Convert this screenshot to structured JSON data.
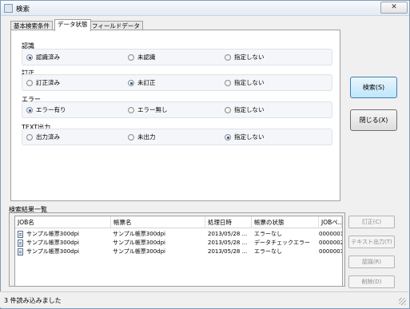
{
  "window": {
    "title": "検索",
    "close_label": "✕"
  },
  "tabs": [
    {
      "label": "基本検索条件",
      "active": false
    },
    {
      "label": "データ状態",
      "active": true
    },
    {
      "label": "フィールドデータ",
      "active": false
    }
  ],
  "groups": [
    {
      "label": "認識",
      "options": [
        "認識済み",
        "未認識",
        "指定しない"
      ],
      "selected": 0
    },
    {
      "label": "訂正",
      "options": [
        "訂正済み",
        "未訂正",
        "指定しない"
      ],
      "selected": 1
    },
    {
      "label": "エラー",
      "options": [
        "エラー有り",
        "エラー無し",
        "指定しない"
      ],
      "selected": 0
    },
    {
      "label": "TEXT出力",
      "options": [
        "出力済み",
        "未出力",
        "指定しない"
      ],
      "selected": 2
    }
  ],
  "buttons": {
    "search": "検索(S)",
    "close": "閉じる(X)"
  },
  "results": {
    "label": "検索結果一覧",
    "columns": [
      "JOB名",
      "帳票名",
      "処理日時",
      "帳票の状態",
      "JOBペ..."
    ],
    "rows": [
      [
        "サンプル帳票300dpi",
        "サンプル帳票300dpi",
        "2013/05/28 ...",
        "エラーなし",
        "0000001"
      ],
      [
        "サンプル帳票300dpi",
        "サンプル帳票300dpi",
        "2013/05/28 ...",
        "データチェックエラー",
        "0000002"
      ],
      [
        "サンプル帳票300dpi",
        "サンプル帳票300dpi",
        "2013/05/28 ...",
        "エラーなし",
        "0000003"
      ]
    ]
  },
  "side_buttons": [
    "訂正(C)",
    "テキスト出力(T)",
    "認識(R)",
    "削除(D)"
  ],
  "status": {
    "text": "3 件読み込みました"
  },
  "colors": {
    "selected_radio": "#1c4f9b",
    "primary_button": "#bee6fd",
    "disabled_text": "#8d8d8d"
  }
}
